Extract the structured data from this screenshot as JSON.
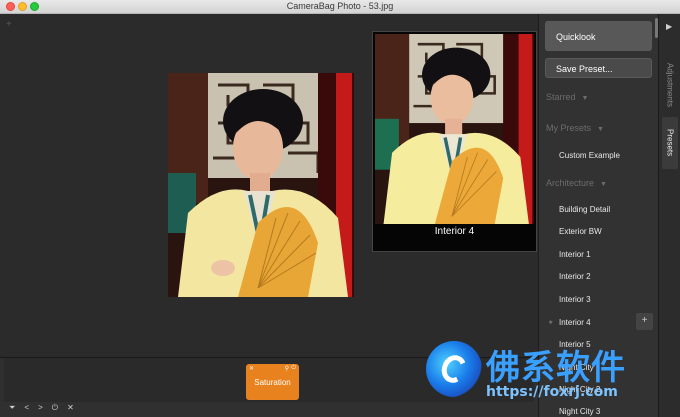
{
  "window": {
    "title": "CameraBag Photo - 53.jpg"
  },
  "canvas": {
    "plus_mark": "+"
  },
  "preview": {
    "label": "Interior 4"
  },
  "bottom": {
    "tile_label": "Saturation",
    "icons": [
      "filter-icon",
      "back-icon",
      "forward-icon",
      "power-icon",
      "close-icon"
    ],
    "icon_glyphs": [
      "⏷",
      "<",
      ">",
      "⏻",
      "✕"
    ]
  },
  "panel": {
    "quicklook": "Quicklook",
    "save_preset": "Save Preset...",
    "sections": {
      "starred": "Starred",
      "my_presets": "My Presets",
      "architecture": "Architecture"
    },
    "my_presets_items": [
      "Custom Example"
    ],
    "architecture_items": [
      "Building Detail",
      "Exterior BW",
      "Interior 1",
      "Interior 2",
      "Interior 3",
      "Interior 4",
      "Interior 5",
      "Night City",
      "Night City 2",
      "Night City 3"
    ],
    "plus": "+"
  },
  "tabs": {
    "adjustments": "Adjustments",
    "presets": "Presets"
  },
  "watermark": {
    "text": "佛系软件",
    "url": "https://foxrj.com"
  }
}
